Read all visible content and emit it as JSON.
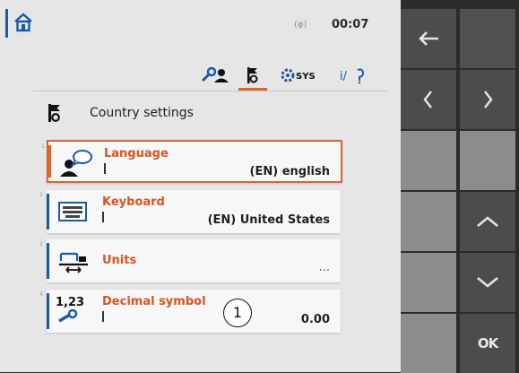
{
  "status": {
    "signal_text": "(φ)",
    "time": "00:07"
  },
  "tabs": [
    {
      "name": "user-tab",
      "icon": "user-settings-icon",
      "active": false
    },
    {
      "name": "country-tab",
      "icon": "country-settings-icon",
      "active": true
    },
    {
      "name": "system-tab",
      "icon": "system-settings-icon",
      "label": "SYS",
      "active": false
    },
    {
      "name": "info-tab",
      "icon": "info-diagnosis-icon",
      "label": "i/",
      "active": false
    }
  ],
  "page": {
    "title": "Country settings",
    "icon": "country-settings-icon"
  },
  "items": [
    {
      "index": "1",
      "label": "Language",
      "value": "(EN) english",
      "icon": "language-icon",
      "selected": true
    },
    {
      "index": "2",
      "label": "Keyboard",
      "value": "(EN) United States",
      "icon": "keyboard-icon",
      "selected": false
    },
    {
      "index": "3",
      "label": "Units",
      "value": "...",
      "icon": "units-icon",
      "selected": false
    },
    {
      "index": "4",
      "label": "Decimal symbol",
      "value": "0.00",
      "icon": "decimal-symbol-icon",
      "icon_text": "1,23",
      "selected": false
    }
  ],
  "callout": "1",
  "softkeys": {
    "ok_label": "OK",
    "icons": [
      "back-arrow-icon",
      "page-left-icon",
      "page-right-icon",
      "scroll-up-icon",
      "scroll-down-icon",
      "ok-icon"
    ]
  },
  "colors": {
    "accent": "#e0632a",
    "blue": "#1c5aa8",
    "panel": "#4c4c4c"
  }
}
